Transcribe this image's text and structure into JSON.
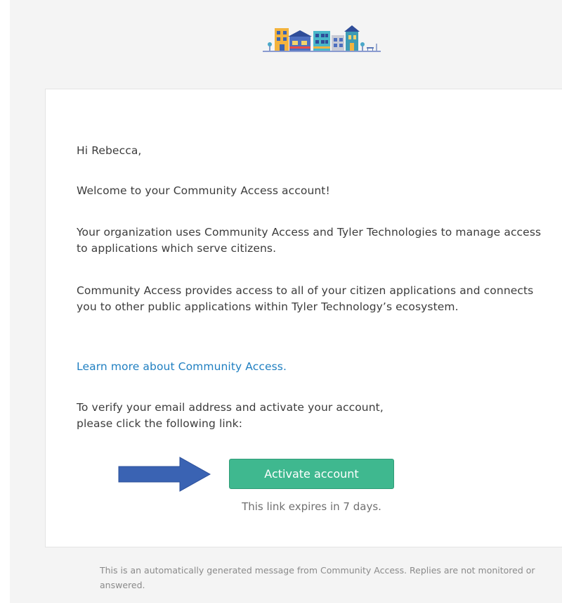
{
  "email": {
    "greeting": "Hi Rebecca,",
    "welcome": "Welcome to your Community Access account!",
    "org_text": "Your organization uses Community Access and Tyler Technologies to manage access to applications which serve citizens.",
    "provides_text": "Community Access provides access to all of your citizen applications and connects you to other public applications within Tyler Technology’s ecosystem.",
    "learn_more_link": "Learn more about Community Access",
    "learn_more_period": ".",
    "verify_text_1": "To verify your email address and activate your account,",
    "verify_text_2": "please click the following link:",
    "activate_button": "Activate account",
    "expires_text": "This link expires in 7 days.",
    "footer_text": "This is an automatically generated message from Community Access. Replies are not monitored or answered."
  },
  "colors": {
    "button": "#3fb88f",
    "link": "#1f7fc1",
    "arrow": "#3a63b3"
  },
  "icons": {
    "logo": "city-buildings-logo",
    "arrow": "right-arrow-icon"
  }
}
